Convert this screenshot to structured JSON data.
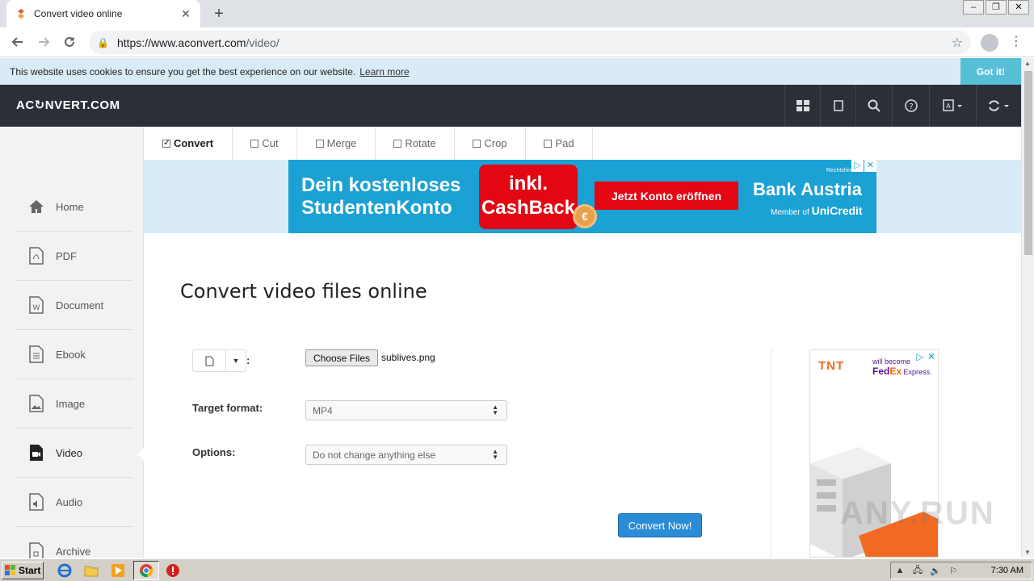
{
  "browser": {
    "tab_title": "Convert video online",
    "url_main": "https://www.aconvert.com",
    "url_path": "/video/"
  },
  "cookie": {
    "message": "This website uses cookies to ensure you get the best experience on our website.",
    "learn_more": "Learn more",
    "got_it": "Got it!"
  },
  "site": {
    "logo": "AC↻NVERT.COM",
    "header_icons": [
      "grid-icon",
      "tablet-icon",
      "search-icon",
      "help-icon",
      "language-icon",
      "refresh-icon"
    ]
  },
  "sidebar": {
    "items": [
      {
        "label": "Home",
        "icon": "home-icon"
      },
      {
        "label": "PDF",
        "icon": "pdf-icon"
      },
      {
        "label": "Document",
        "icon": "document-icon"
      },
      {
        "label": "Ebook",
        "icon": "ebook-icon"
      },
      {
        "label": "Image",
        "icon": "image-icon"
      },
      {
        "label": "Video",
        "icon": "video-icon",
        "active": true
      },
      {
        "label": "Audio",
        "icon": "audio-icon"
      },
      {
        "label": "Archive",
        "icon": "archive-icon"
      }
    ]
  },
  "tooltabs": [
    {
      "label": "Convert",
      "active": true
    },
    {
      "label": "Cut"
    },
    {
      "label": "Merge"
    },
    {
      "label": "Rotate"
    },
    {
      "label": "Crop"
    },
    {
      "label": "Pad"
    }
  ],
  "ad": {
    "line1": "Dein kostenloses",
    "line2": "StudentenKonto",
    "cash1": "inkl.",
    "cash2": "CashBack",
    "coin": "€",
    "cta": "Jetzt Konto eröffnen",
    "bank": "Bank Austria",
    "member_prefix": "Member of",
    "member_brand": "UniCredit",
    "rechts": "Rechtshin"
  },
  "main": {
    "title": "Convert video files online",
    "colon": ":",
    "choose_files": "Choose Files",
    "file_name": "sublives.png",
    "target_label": "Target format:",
    "target_value": "MP4",
    "options_label": "Options:",
    "options_value": "Do not change anything else",
    "convert_button": "Convert Now!"
  },
  "side_ad": {
    "tnt": "TNT",
    "fedex_top": "will become",
    "fedex_fed": "Fed",
    "fedex_ex": "Ex",
    "fedex_express": "Express."
  },
  "watermark": "ANY.RUN",
  "taskbar": {
    "start": "Start",
    "time": "7:30 AM"
  },
  "colors": {
    "header_bg": "#2b3038",
    "cookie_bg": "#d9ebf6",
    "got_it_bg": "#57bfd6",
    "ad_blue": "#1ba1d4",
    "ad_red": "#e30613",
    "convert_blue": "#2a8bd6"
  }
}
